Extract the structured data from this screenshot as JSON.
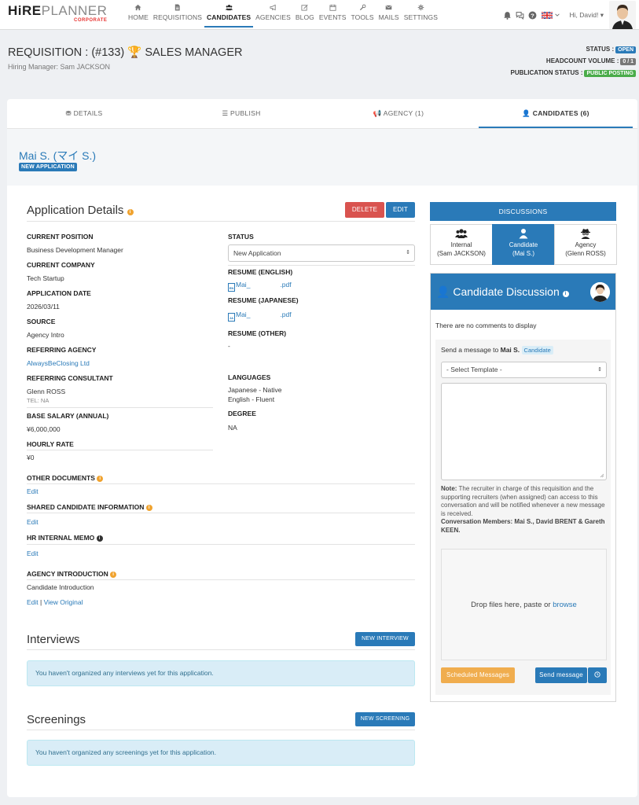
{
  "app": {
    "logo_bold": "HiRE",
    "logo_light": "PLANNER",
    "logo_sub": "CORPORATE"
  },
  "nav": {
    "items": [
      {
        "label": "HOME",
        "icon": "home-icon"
      },
      {
        "label": "REQUISITIONS",
        "icon": "file-icon"
      },
      {
        "label": "CANDIDATES",
        "icon": "users-icon",
        "active": true
      },
      {
        "label": "AGENCIES",
        "icon": "bullhorn-icon"
      },
      {
        "label": "BLOG",
        "icon": "edit-icon"
      },
      {
        "label": "EVENTS",
        "icon": "calendar-icon"
      },
      {
        "label": "TOOLS",
        "icon": "wrench-icon"
      },
      {
        "label": "MAILS",
        "icon": "envelope-icon"
      },
      {
        "label": "SETTINGS",
        "icon": "gear-icon"
      }
    ],
    "greeting": "Hi, David! ▾"
  },
  "requisition": {
    "title": "REQUISITION : (#133)",
    "trophy": "🏆",
    "position": "SALES MANAGER",
    "hiring_manager": "Hiring Manager: Sam JACKSON",
    "status_label": "STATUS :",
    "status_value": "OPEN",
    "headcount_label": "HEADCOUNT VOLUME :",
    "headcount_value": "0 / 1",
    "publication_label": "PUBLICATION STATUS :",
    "publication_value": "PUBLIC POSTING"
  },
  "tabs": [
    {
      "label": "DETAILS",
      "icon": "⛃"
    },
    {
      "label": "PUBLISH",
      "icon": "☰"
    },
    {
      "label": "AGENCY (1)",
      "icon": "📢"
    },
    {
      "label": "CANDIDATES (6)",
      "icon": "👤",
      "active": true
    }
  ],
  "candidate": {
    "name": "Mai S. (マイ S.)",
    "badge": "NEW APPLICATION"
  },
  "application": {
    "title": "Application Details",
    "delete_label": "DELETE",
    "edit_label": "EDIT",
    "fields_left": [
      {
        "label": "CURRENT POSITION",
        "value": "Business Development Manager"
      },
      {
        "label": "CURRENT COMPANY",
        "value": "Tech Startup"
      },
      {
        "label": "APPLICATION DATE",
        "value": "2026/03/11"
      },
      {
        "label": "SOURCE",
        "value": "Agency Intro"
      },
      {
        "label": "REFERRING AGENCY",
        "value": "AlwaysBeClosing Ltd"
      },
      {
        "label": "REFERRING CONSULTANT",
        "value": "Glenn ROSS",
        "sub": "TEL: NA"
      },
      {
        "label": "BASE SALARY (ANNUAL)",
        "value": "¥6,000,000"
      },
      {
        "label": "HOURLY RATE",
        "value": "¥0"
      }
    ],
    "status_label": "STATUS",
    "status_value": "New Application",
    "resume_en_label": "RESUME (ENGLISH)",
    "resume_en_file_a": "Mai_",
    "resume_en_file_b": ".pdf",
    "resume_jp_label": "RESUME (JAPANESE)",
    "resume_jp_file_a": "Mai_",
    "resume_jp_file_b": ".pdf",
    "resume_other_label": "RESUME (OTHER)",
    "resume_other_value": "-",
    "languages_label": "LANGUAGES",
    "languages": [
      "Japanese - Native",
      "English - Fluent"
    ],
    "degree_label": "DEGREE",
    "degree_value": "NA",
    "other_docs_label": "OTHER DOCUMENTS",
    "other_docs_action": "Edit",
    "shared_info_label": "SHARED CANDIDATE INFORMATION",
    "shared_info_action": "Edit",
    "hr_memo_label": "HR INTERNAL MEMO",
    "hr_memo_action": "Edit",
    "agency_intro_label": "AGENCY INTRODUCTION",
    "agency_intro_value": "Candidate Introduction",
    "agency_intro_edit": "Edit",
    "agency_intro_sep": " | ",
    "agency_intro_view": "View Original"
  },
  "interviews": {
    "title": "Interviews",
    "button": "NEW INTERVIEW",
    "empty": "You haven't organized any interviews yet for this application."
  },
  "screenings": {
    "title": "Screenings",
    "button": "NEW SCREENING",
    "empty": "You haven't organized any screenings yet for this application."
  },
  "discussions": {
    "header": "DISCUSSIONS",
    "tabs": [
      {
        "title": "Internal",
        "sub": "(Sam JACKSON)"
      },
      {
        "title": "Candidate",
        "sub": "(Mai S.)",
        "active": true
      },
      {
        "title": "Agency",
        "sub": "(Glenn ROSS)"
      }
    ],
    "panel_title": "Candidate Discussion",
    "no_comments": "There are no comments to display",
    "send_to_prefix": "Send a message to ",
    "send_to_name": "Mai S.",
    "send_to_badge": "Candidate",
    "template_placeholder": "- Select Template -",
    "note_label": "Note:",
    "note_text": " The recruiter in charge of this requisition and the supporting recruiters (when assigned) can access to this conversation and will be notified whenever a new message is received.",
    "members": "Conversation Members: Mai S., David BRENT & Gareth KEEN.",
    "drop_text": "Drop files here, paste or ",
    "drop_link": "browse",
    "scheduled_button": "Scheduled Messages",
    "send_button": "Send message"
  }
}
